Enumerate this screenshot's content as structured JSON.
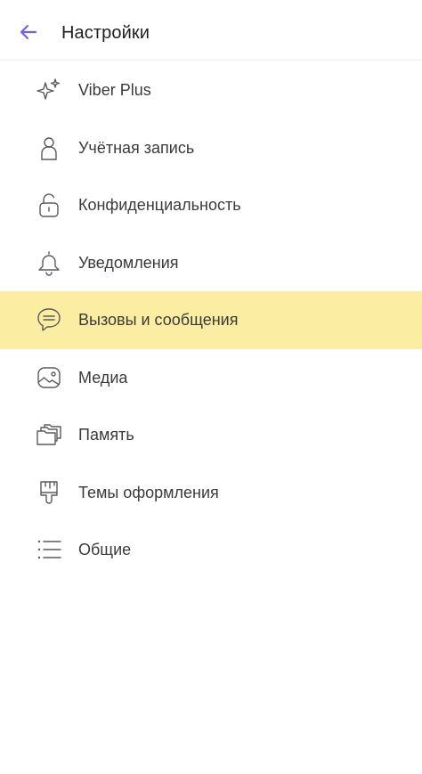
{
  "header": {
    "title": "Настройки",
    "back_icon": "arrow-left-icon",
    "accent_color": "#7360f2"
  },
  "menu": {
    "highlight_color": "#fbeea3",
    "items": [
      {
        "label": "Viber Plus",
        "icon": "sparkles-icon"
      },
      {
        "label": "Учётная запись",
        "icon": "user-icon"
      },
      {
        "label": "Конфиденциальность",
        "icon": "lock-icon"
      },
      {
        "label": "Уведомления",
        "icon": "bell-icon"
      },
      {
        "label": "Вызовы и сообщения",
        "icon": "chat-bubble-icon",
        "highlighted": true
      },
      {
        "label": "Медиа",
        "icon": "image-icon"
      },
      {
        "label": "Память",
        "icon": "folders-icon"
      },
      {
        "label": "Темы оформления",
        "icon": "paint-brush-icon"
      },
      {
        "label": "Общие",
        "icon": "list-icon"
      }
    ]
  }
}
